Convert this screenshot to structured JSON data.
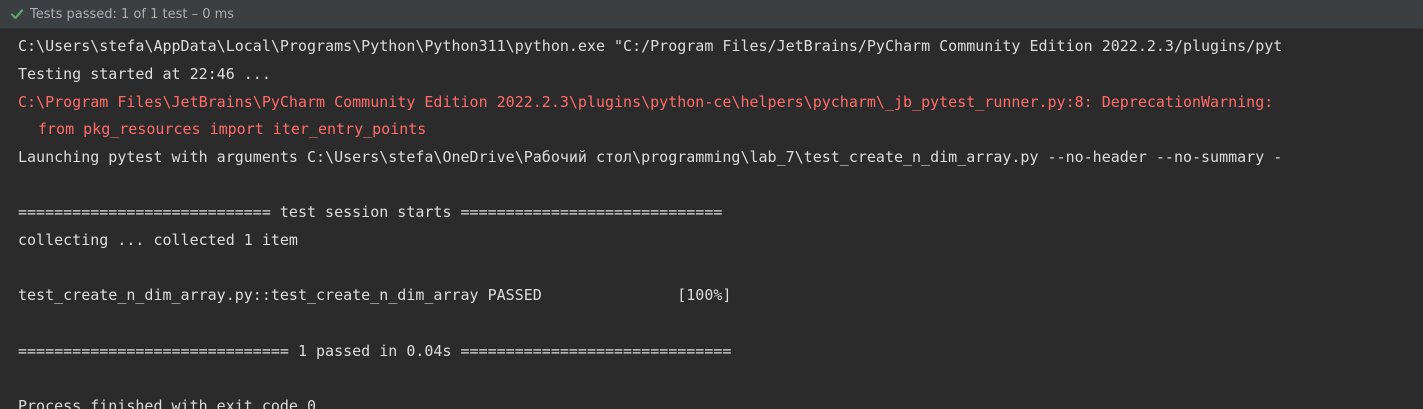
{
  "status": {
    "icon": "check-icon",
    "text": "Tests passed: 1 of 1 test – 0 ms",
    "icon_color": "#59a869"
  },
  "console": {
    "lines": [
      "C:\\Users\\stefa\\AppData\\Local\\Programs\\Python\\Python311\\python.exe \"C:/Program Files/JetBrains/PyCharm Community Edition 2022.2.3/plugins/pyt",
      "Testing started at 22:46 ...",
      "C:\\Program Files\\JetBrains\\PyCharm Community Edition 2022.2.3\\plugins\\python-ce\\helpers\\pycharm\\_jb_pytest_runner.py:8: DeprecationWarning:",
      "from pkg_resources import iter_entry_points",
      "Launching pytest with arguments C:\\Users\\stefa\\OneDrive\\Рабочий стол\\programming\\lab_7\\test_create_n_dim_array.py --no-header --no-summary -",
      "============================ test session starts =============================",
      "collecting ... collected 1 item",
      "test_create_n_dim_array.py::test_create_n_dim_array PASSED               [100%]",
      "============================== 1 passed in 0.04s ==============================",
      "Process finished with exit code 0"
    ],
    "colors": {
      "normal": "#dcdcdc",
      "error": "#ff6b68",
      "background": "#2b2b2b"
    }
  }
}
